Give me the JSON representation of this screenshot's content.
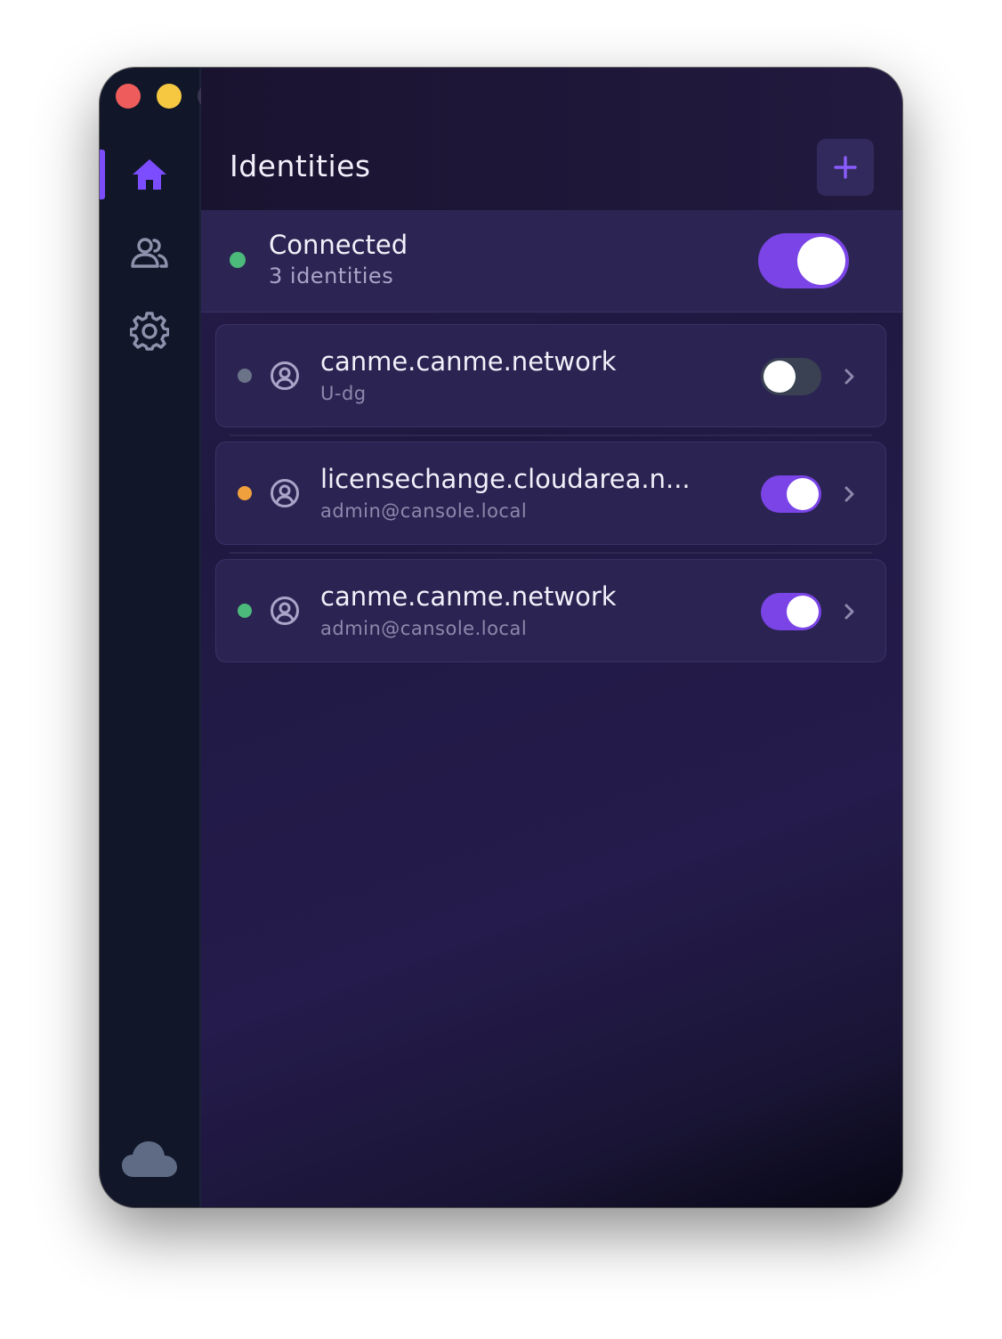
{
  "window": {
    "controls": [
      "close",
      "minimize",
      "maximize"
    ]
  },
  "sidebar": {
    "items": [
      {
        "icon": "home-icon",
        "active": true
      },
      {
        "icon": "users-icon",
        "active": false
      },
      {
        "icon": "gear-icon",
        "active": false
      }
    ],
    "footer_icon": "cloud-icon"
  },
  "header": {
    "title": "Identities",
    "add_icon": "plus-icon"
  },
  "status": {
    "title": "Connected",
    "subtitle": "3 identities",
    "enabled": true
  },
  "identities": [
    {
      "name": "canme.canme.network",
      "detail": "U-dg",
      "status_color": "#6b7388",
      "enabled": false
    },
    {
      "name": "licensechange.cloudarea.n...",
      "detail": "admin@cansole.local",
      "status_color": "#f0a03c",
      "enabled": true
    },
    {
      "name": "canme.canme.network",
      "detail": "admin@cansole.local",
      "status_color": "#4cba7a",
      "enabled": true
    }
  ],
  "colors": {
    "accent": "#7a44e6",
    "connected": "#4cba7a",
    "warning": "#f0a03c",
    "offline": "#6b7388"
  }
}
